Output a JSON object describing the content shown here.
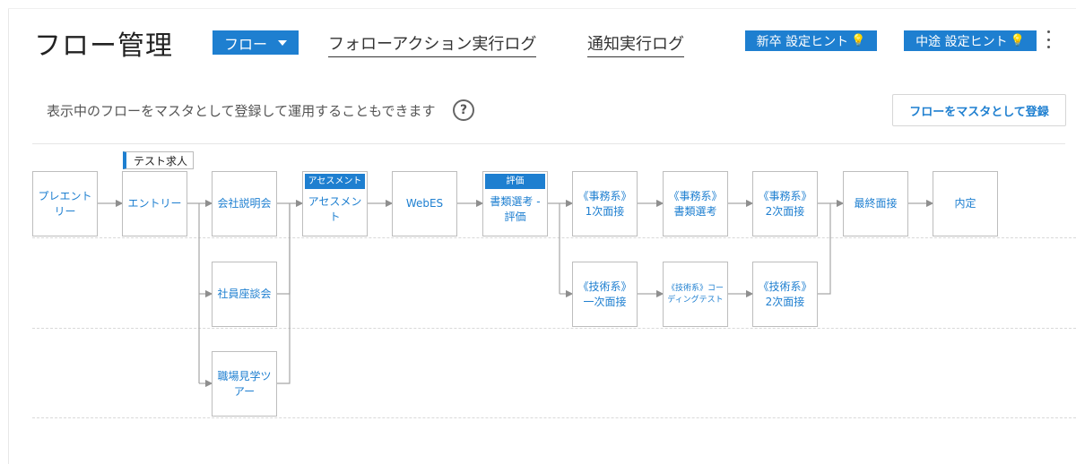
{
  "header": {
    "title": "フロー管理",
    "flow_dropdown": "フロー",
    "tabs": [
      "フォローアクション実行ログ",
      "通知実行ログ"
    ],
    "hint_new_grad": "新卒 設定ヒント",
    "hint_mid_career": "中途 設定ヒント"
  },
  "description": "表示中のフローをマスタとして登録して運用することもできます",
  "help_label": "?",
  "register_button": "フローをマスタとして登録",
  "test_tag": "テスト求人",
  "flow": {
    "pre_entry": "プレエント\nリー",
    "entry": "エントリー",
    "company_briefing": "会社説明会",
    "employee_meeting": "社員座談会",
    "workplace_tour": "職場見学ツ\nアー",
    "assessment_tag": "アセスメント",
    "assessment": "アセスメン\nト",
    "webes": "WebES",
    "evaluation_tag": "評価",
    "document_screening": "書類選考 -\n評価",
    "office_1st": "《事務系》\n1次面接",
    "office_docs": "《事務系》\n書類選考",
    "office_2nd": "《事務系》\n2次面接",
    "tech_1st": "《技術系》\n一次面接",
    "tech_coding": "《技術系》コー\nディングテスト",
    "tech_2nd": "《技術系》\n2次面接",
    "final_interview": "最終面接",
    "offer": "内定"
  },
  "colors": {
    "accent": "#1e7fd0",
    "node_border": "#bdbdbd",
    "connector": "#a6a6a6"
  }
}
